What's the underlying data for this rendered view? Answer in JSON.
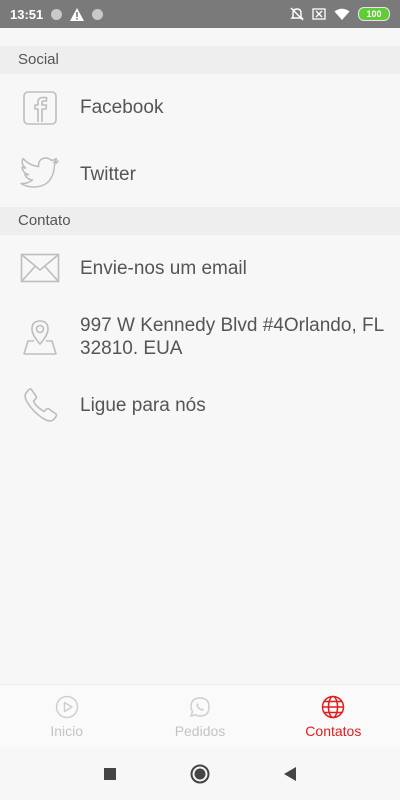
{
  "status_bar": {
    "time": "13:51",
    "battery": "100",
    "icons": [
      "notification-dot-icon",
      "warning-icon",
      "notification-dot-icon",
      "mute-icon",
      "sim-off-icon",
      "wifi-icon",
      "battery-icon"
    ]
  },
  "sections": {
    "social": {
      "title": "Social",
      "items": [
        {
          "label": "Facebook",
          "icon": "facebook-icon"
        },
        {
          "label": "Twitter",
          "icon": "twitter-icon"
        }
      ]
    },
    "contato": {
      "title": "Contato",
      "items": [
        {
          "label": "Envie-nos um email",
          "icon": "envelope-icon"
        },
        {
          "label": "997 W Kennedy Blvd #4Orlando, FL 32810. EUA",
          "icon": "map-pin-icon"
        },
        {
          "label": "Ligue para nós",
          "icon": "phone-icon"
        }
      ]
    }
  },
  "bottom_nav": {
    "items": [
      {
        "label": "Inicio",
        "icon": "play-circle-icon"
      },
      {
        "label": "Pedidos",
        "icon": "whatsapp-icon"
      },
      {
        "label": "Contatos",
        "icon": "globe-icon",
        "active": true
      }
    ]
  },
  "colors": {
    "accent": "#e21b1b",
    "status_bar_bg": "#7a7a7a",
    "section_header_bg": "#eeeeee",
    "icon_gray": "#bdbdbd",
    "inactive_nav": "#c4c4c4"
  }
}
